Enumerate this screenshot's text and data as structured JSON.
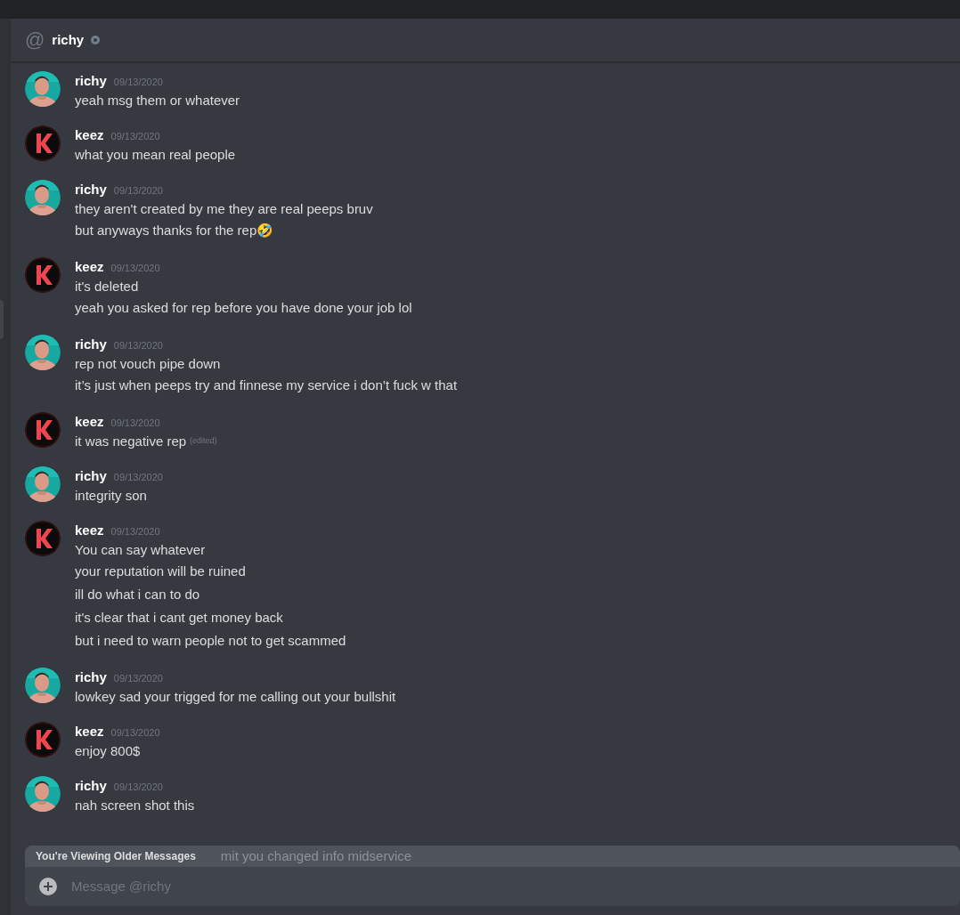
{
  "header": {
    "at_sign": "@",
    "name": "richy",
    "online": false
  },
  "messages": [
    {
      "author": "richy",
      "kind": "picture",
      "time": "09/13/2020",
      "lines": [
        {
          "text": "yeah msg them or whatever"
        }
      ]
    },
    {
      "author": "keez",
      "kind": "logo",
      "time": "09/13/2020",
      "lines": [
        {
          "text": "what you mean real people"
        }
      ]
    },
    {
      "author": "richy",
      "kind": "picture",
      "time": "09/13/2020",
      "lines": [
        {
          "text": "they aren't created by me they are real peeps bruv"
        },
        {
          "text": "but anyways thanks for the rep🤣"
        }
      ]
    },
    {
      "author": "keez",
      "kind": "logo",
      "time": "09/13/2020",
      "lines": [
        {
          "text": "it's deleted"
        },
        {
          "text": "yeah you asked for rep before you have done your job lol"
        }
      ]
    },
    {
      "author": "richy",
      "kind": "picture",
      "time": "09/13/2020",
      "lines": [
        {
          "text": "rep not vouch pipe down"
        },
        {
          "text": "it’s just when peeps try and finnese my service i don’t fuck w that"
        }
      ]
    },
    {
      "author": "keez",
      "kind": "logo",
      "time": "09/13/2020",
      "lines": [
        {
          "text": "it was negative rep",
          "edited_label": "(edited)"
        }
      ]
    },
    {
      "author": "richy",
      "kind": "picture",
      "time": "09/13/2020",
      "lines": [
        {
          "text": "integrity son"
        }
      ]
    },
    {
      "author": "keez",
      "kind": "logo",
      "time": "09/13/2020",
      "lines": [
        {
          "text": "You can say whatever"
        },
        {
          "text": "your reputation will be ruined"
        },
        {
          "text": "ill do what i can to do"
        },
        {
          "text": "it's clear that i cant get money back"
        },
        {
          "text": "but i need to warn people not to get scammed"
        }
      ]
    },
    {
      "author": "richy",
      "kind": "picture",
      "time": "09/13/2020",
      "lines": [
        {
          "text": "lowkey sad your trigged for me calling out your bullshit"
        }
      ]
    },
    {
      "author": "keez",
      "kind": "logo",
      "time": "09/13/2020",
      "lines": [
        {
          "text": "enjoy 800$"
        }
      ]
    },
    {
      "author": "richy",
      "kind": "picture",
      "time": "09/13/2020",
      "lines": [
        {
          "text": "nah screen shot this"
        }
      ]
    }
  ],
  "older_banner": {
    "title": "You're Viewing Older Messages",
    "covered_text": "mit you changed info midservice"
  },
  "composer": {
    "placeholder": "Message @richy"
  }
}
